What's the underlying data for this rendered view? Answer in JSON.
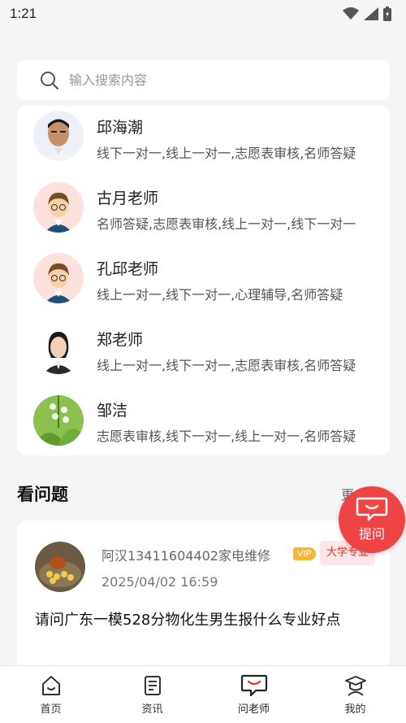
{
  "status_bar": {
    "time": "1:21"
  },
  "search": {
    "placeholder": "输入搜索内容"
  },
  "teachers": [
    {
      "name": "邱海潮",
      "tags": "线下一对一,线上一对一,志愿表审核,名师答疑",
      "avatar": "man-photo"
    },
    {
      "name": "古月老师",
      "tags": "名师答疑,志愿表审核,线上一对一,线下一对一",
      "avatar": "cartoon-teacher"
    },
    {
      "name": "孔邱老师",
      "tags": "线上一对一,线下一对一,心理辅导,名师答疑",
      "avatar": "cartoon-teacher"
    },
    {
      "name": "郑老师",
      "tags": "线上一对一,线下一对一,志愿表审核,名师答疑",
      "avatar": "woman-photo"
    },
    {
      "name": "邹洁",
      "tags": "志愿表审核,线下一对一,线上一对一,名师答疑",
      "avatar": "flower-photo"
    }
  ],
  "questions_section": {
    "title": "看问题",
    "more": "更多"
  },
  "question": {
    "user": "阿汉13411604402家电维修",
    "vip": "VIP",
    "badge": "大学专业",
    "time": "2025/04/02 16:59",
    "text": "请问广东一模528分物化生男生报什么专业好点"
  },
  "ask_button": {
    "label": "提问"
  },
  "nav": [
    {
      "label": "首页",
      "icon": "home-icon"
    },
    {
      "label": "资讯",
      "icon": "news-icon"
    },
    {
      "label": "问老师",
      "icon": "ask-teacher-icon"
    },
    {
      "label": "我的",
      "icon": "profile-icon"
    }
  ],
  "colors": {
    "accent": "#ee4444",
    "vip": "#f7b733",
    "badge_text": "#e0343d",
    "badge_bg": "#fde6e7"
  }
}
